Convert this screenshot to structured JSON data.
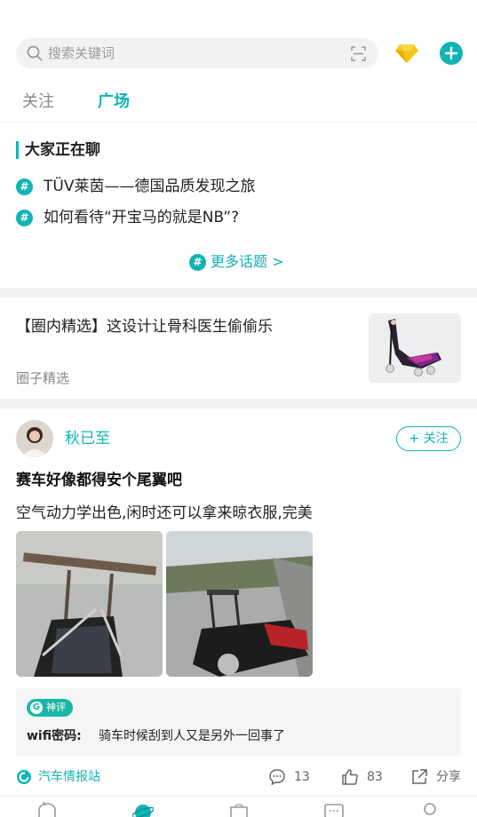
{
  "search": {
    "placeholder": "搜索关键词"
  },
  "tabs": [
    {
      "label": "关注"
    },
    {
      "label": "广场"
    }
  ],
  "trending": {
    "title": "大家正在聊",
    "topics": [
      {
        "hash": "#",
        "text": "TÜV莱茵——德国品质发现之旅"
      },
      {
        "hash": "#",
        "text": "如何看待“开宝马的就是NB”?"
      }
    ],
    "more_label": "更多话题 >"
  },
  "featured": {
    "title": "【圈内精选】这设计让骨科医生偷偷乐",
    "source": "圈子精选"
  },
  "post": {
    "username": "秋已至",
    "follow_label": "+ 关注",
    "title": "赛车好像都得安个尾翼吧",
    "body": "空气动力学出色,闲时还可以拿来晾衣服,完美",
    "comment": {
      "badge": "神评",
      "badge_icon": "G",
      "user": "wifi密码:",
      "text": "骑车时候刮到人又是另外一回事了"
    },
    "circle": "汽车情报站",
    "comments_count": "13",
    "likes_count": "83",
    "share_label": "分享"
  },
  "colors": {
    "accent": "#11b3b4",
    "badge": "#19b7a6",
    "gem": "#f5c518"
  },
  "icons": {
    "search": "search-icon",
    "scan": "scan-icon",
    "vip": "diamond-icon",
    "add": "plus-icon",
    "comment": "comment-bubble-icon",
    "like": "thumb-up-icon",
    "share": "share-icon"
  }
}
